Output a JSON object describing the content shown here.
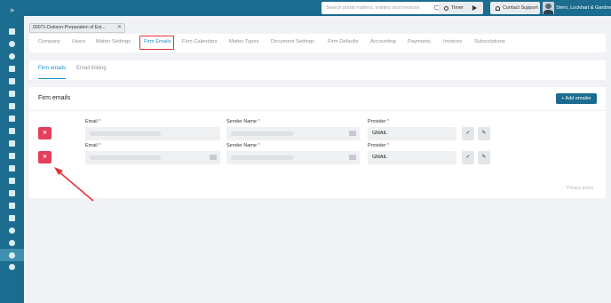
{
  "topbar": {
    "search_placeholder": "Search portal matters, entities and invoices",
    "timer_label": "Timer",
    "support_label": "Contact Support",
    "user_name": "Stern, Lockhart & Gardner"
  },
  "matter_tab": {
    "label": "00071-Dobson-Preparation of Est...",
    "close": "✕"
  },
  "sidebar": {
    "toggle": "»",
    "icons": [
      "layers-icon",
      "users-icon",
      "user-upload-icon",
      "building-icon",
      "home-icon",
      "calendar-icon",
      "check-square-icon",
      "image-icon",
      "file-icon",
      "bank-icon",
      "arrow-right-icon",
      "arrow-left-icon",
      "repeat-icon",
      "document-icon",
      "list-icon",
      "stack-icon",
      "user-download-icon",
      "user-circle-icon",
      "gear-icon",
      "help-icon"
    ],
    "active_index": 18
  },
  "nav_tabs": [
    "Company",
    "Users",
    "Matter Settings",
    "Firm Emails",
    "Firm Calendars",
    "Matter Types",
    "Document Settings",
    "Firm Defaults",
    "Accounting",
    "Payments",
    "Invoices",
    "Subscriptions"
  ],
  "nav_active": "Firm Emails",
  "sub_tabs": [
    "Firm emails",
    "Email linking"
  ],
  "sub_active": "Firm emails",
  "card": {
    "title": "Firm emails",
    "add_button": "+ Add emailer",
    "email_label": "Email",
    "sender_label": "Sender Name",
    "provider_label": "Provider",
    "required_mark": "*",
    "rows": [
      {
        "provider": "GMAIL",
        "delete": "✕",
        "confirm": "✓",
        "edit": "✎"
      },
      {
        "provider": "GMAIL",
        "delete": "✕",
        "confirm": "✓",
        "edit": "✎"
      }
    ],
    "privacy": "Privacy policy"
  },
  "colors": {
    "sidebar": "#1b6c8e",
    "accent": "#1d8fcf",
    "delete": "#e2405c",
    "highlight": "#e0333a"
  }
}
